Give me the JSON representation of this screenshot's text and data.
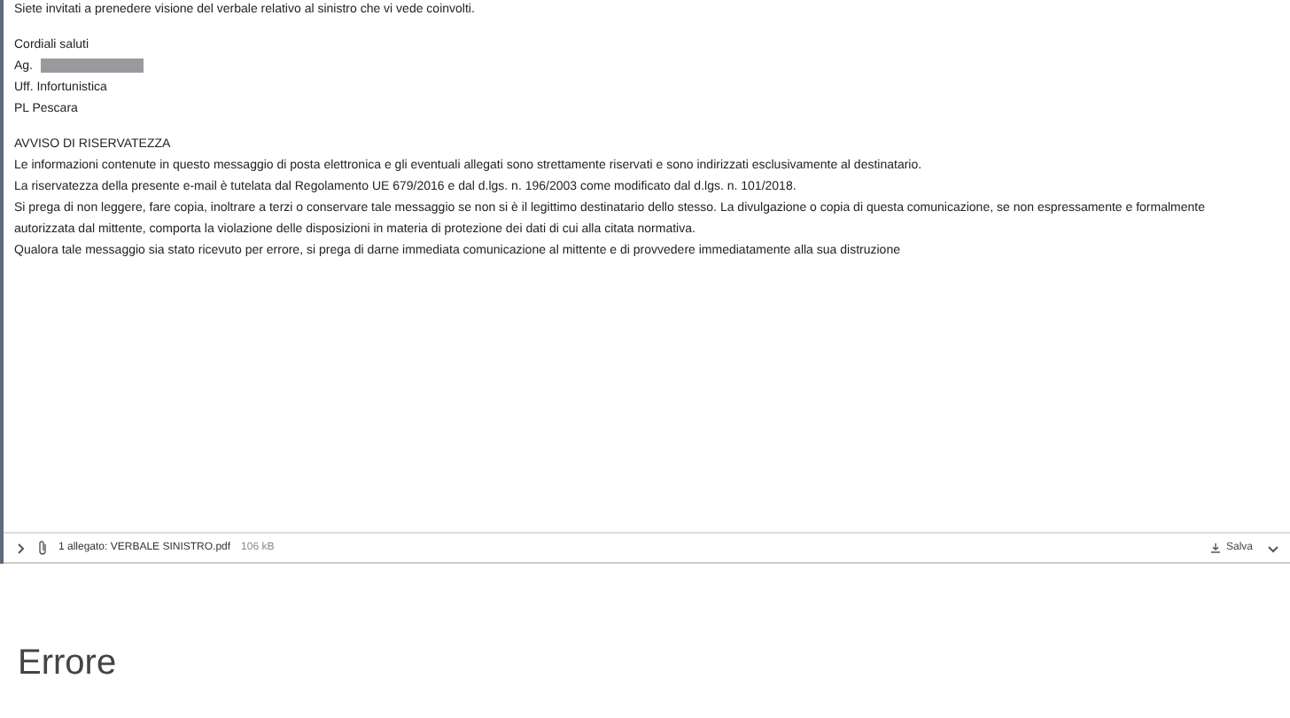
{
  "email": {
    "body": [
      {
        "kind": "line",
        "text": "Siete invitati a prenedere visione del verbale relativo al sinistro che vi vede coinvolti."
      },
      {
        "kind": "gap"
      },
      {
        "kind": "line",
        "text": "Cordiali saluti"
      },
      {
        "kind": "redacted",
        "text": "Ag."
      },
      {
        "kind": "line",
        "text": "Uff. Infortunistica"
      },
      {
        "kind": "line",
        "text": "PL Pescara"
      },
      {
        "kind": "gap"
      },
      {
        "kind": "line",
        "text": "AVVISO DI RISERVATEZZA"
      },
      {
        "kind": "line",
        "text": "Le informazioni contenute in questo messaggio di posta elettronica e gli eventuali allegati sono strettamente riservati e sono indirizzati esclusivamente al destinatario."
      },
      {
        "kind": "line",
        "text": "La riservatezza della presente e-mail è tutelata dal Regolamento UE 679/2016 e dal d.lgs. n. 196/2003 come modificato dal d.lgs. n. 101/2018."
      },
      {
        "kind": "line",
        "text": "Si prega di non leggere, fare copia, inoltrare a terzi o conservare tale messaggio se non si è il legittimo destinatario dello stesso. La divulgazione o copia di questa comunicazione, se non espressamente e formalmente autorizzata dal mittente, comporta la violazione delle disposizioni in materia di protezione dei dati di cui alla citata normativa."
      },
      {
        "kind": "line",
        "text": "Qualora tale messaggio sia stato ricevuto per errore, si prega di darne immediata comunicazione al mittente e di provvedere immediatamente alla sua distruzione"
      }
    ]
  },
  "attachment": {
    "expanded": false,
    "label": "1 allegato: VERBALE SINISTRO.pdf",
    "size": "106 kB",
    "save": "Salva"
  },
  "error_title": "Errore"
}
